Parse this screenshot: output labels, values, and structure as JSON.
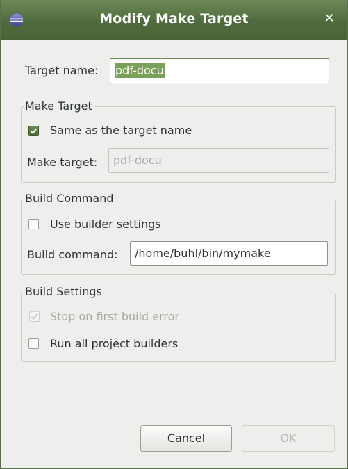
{
  "window": {
    "title": "Modify Make Target",
    "close_glyph": "✕",
    "icon": "eclipse-icon"
  },
  "target_name": {
    "label": "Target name:",
    "value": "pdf-docu"
  },
  "make_target_group": {
    "title": "Make Target",
    "same_as_target_label": "Same as the target name",
    "same_as_target_checked": true,
    "make_target_label": "Make target:",
    "make_target_value": "pdf-docu"
  },
  "build_command_group": {
    "title": "Build Command",
    "use_builder_label": "Use builder settings",
    "use_builder_checked": false,
    "build_command_label": "Build command:",
    "build_command_value": "/home/buhl/bin/mymake"
  },
  "build_settings_group": {
    "title": "Build Settings",
    "stop_on_error_label": "Stop on first build error",
    "stop_on_error_checked": true,
    "stop_on_error_enabled": false,
    "run_all_label": "Run all project builders",
    "run_all_checked": false
  },
  "buttons": {
    "cancel": "Cancel",
    "ok": "OK"
  },
  "colors": {
    "titlebar": "#4f6a3c",
    "selection": "#7aa05a",
    "checkbox_checked": "#4d6b36"
  }
}
